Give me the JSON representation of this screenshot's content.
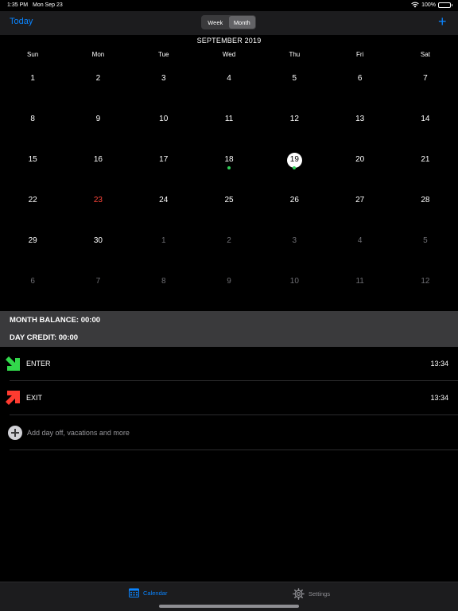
{
  "status": {
    "time": "1:35 PM",
    "date": "Mon Sep 23",
    "battery": "100%"
  },
  "nav": {
    "today_label": "Today",
    "segments": [
      "Week",
      "Month"
    ],
    "selected_segment": "Month",
    "add_label": "+"
  },
  "calendar": {
    "title": "SEPTEMBER 2019",
    "weekdays": [
      "Sun",
      "Mon",
      "Tue",
      "Wed",
      "Thu",
      "Fri",
      "Sat"
    ],
    "weeks": [
      [
        "1",
        "2",
        "3",
        "4",
        "5",
        "6",
        "7"
      ],
      [
        "8",
        "9",
        "10",
        "11",
        "12",
        "13",
        "14"
      ],
      [
        "15",
        "16",
        "17",
        "18",
        "19",
        "20",
        "21"
      ],
      [
        "22",
        "23",
        "24",
        "25",
        "26",
        "27",
        "28"
      ],
      [
        "29",
        "30",
        "1",
        "2",
        "3",
        "4",
        "5"
      ],
      [
        "6",
        "7",
        "8",
        "9",
        "10",
        "11",
        "12"
      ]
    ],
    "current_day": "23",
    "selected_day": "19",
    "days_with_events": [
      "18",
      "19"
    ],
    "event_dot_color": "#30d158",
    "today_color": "#ff453a"
  },
  "balance": {
    "month_balance": "MONTH BALANCE: 00:00",
    "day_credit": "DAY CREDIT: 00:00"
  },
  "entries": [
    {
      "label": "ENTER",
      "time": "13:34",
      "icon": "green-arrow-down-right-icon",
      "color": "#32d74b"
    },
    {
      "label": "EXIT",
      "time": "13:34",
      "icon": "red-arrow-up-right-icon",
      "color": "#ff3b30"
    }
  ],
  "add_row": {
    "label": "Add day off, vacations and more"
  },
  "tabs": [
    {
      "label": "Calendar",
      "icon": "calendar-icon",
      "active": true
    },
    {
      "label": "Settings",
      "icon": "gear-icon",
      "active": false
    }
  ],
  "colors": {
    "accent": "#0a84ff",
    "background": "#000000",
    "panel": "#3a3a3c"
  }
}
